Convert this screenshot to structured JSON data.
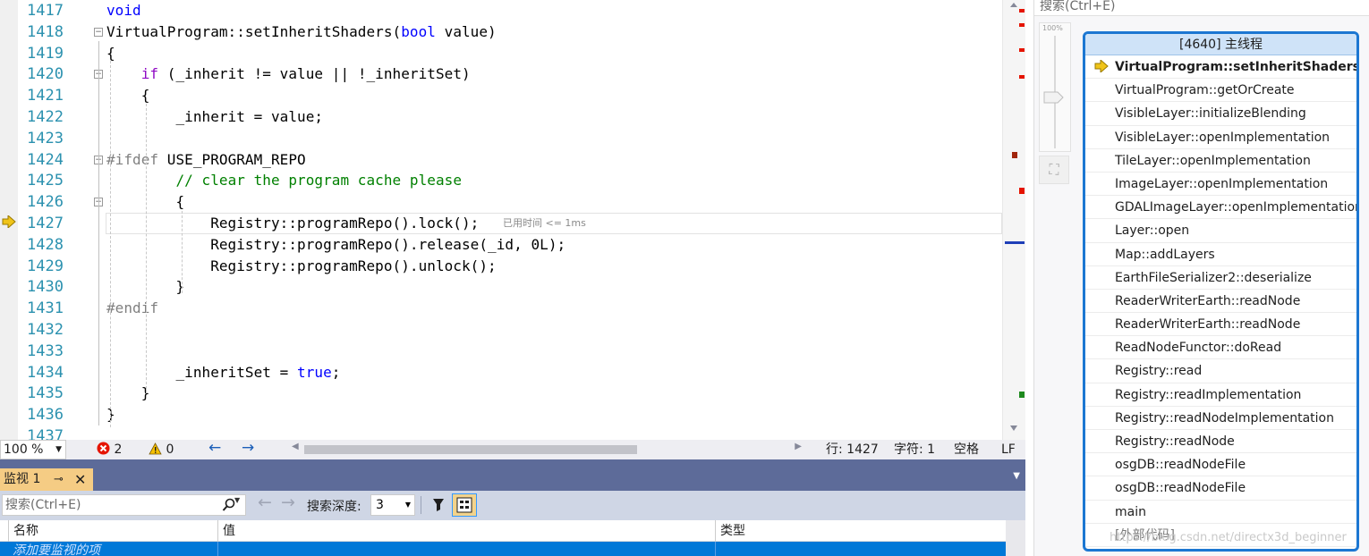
{
  "editor": {
    "lines": [
      {
        "num": "1417",
        "segments": [
          {
            "t": "void",
            "c": "kw"
          }
        ]
      },
      {
        "num": "1418",
        "segments": [
          {
            "t": "VirtualProgram::setInheritShaders(",
            "c": ""
          },
          {
            "t": "bool",
            "c": "kw"
          },
          {
            "t": " value)",
            "c": ""
          }
        ]
      },
      {
        "num": "1419",
        "segments": [
          {
            "t": "{",
            "c": ""
          }
        ]
      },
      {
        "num": "1420",
        "segments": [
          {
            "t": "    ",
            "c": ""
          },
          {
            "t": "if",
            "c": "kw2"
          },
          {
            "t": " (_inherit != value || !_inheritSet)",
            "c": ""
          }
        ]
      },
      {
        "num": "1421",
        "segments": [
          {
            "t": "    {",
            "c": ""
          }
        ]
      },
      {
        "num": "1422",
        "segments": [
          {
            "t": "        _inherit = value;",
            "c": ""
          }
        ]
      },
      {
        "num": "1423",
        "segments": []
      },
      {
        "num": "1424",
        "segments": [
          {
            "t": "#ifdef",
            "c": "pp"
          },
          {
            "t": " USE_PROGRAM_REPO",
            "c": ""
          }
        ]
      },
      {
        "num": "1425",
        "segments": [
          {
            "t": "        ",
            "c": ""
          },
          {
            "t": "// clear the program cache please",
            "c": "cm"
          }
        ]
      },
      {
        "num": "1426",
        "segments": [
          {
            "t": "        {",
            "c": ""
          }
        ]
      },
      {
        "num": "1427",
        "segments": [
          {
            "t": "            Registry::programRepo().lock();",
            "c": ""
          }
        ]
      },
      {
        "num": "1428",
        "segments": [
          {
            "t": "            Registry::programRepo().release(_id, 0L);",
            "c": ""
          }
        ]
      },
      {
        "num": "1429",
        "segments": [
          {
            "t": "            Registry::programRepo().unlock();",
            "c": ""
          }
        ]
      },
      {
        "num": "1430",
        "segments": [
          {
            "t": "        }",
            "c": ""
          }
        ]
      },
      {
        "num": "1431",
        "segments": [
          {
            "t": "#endif",
            "c": "pp"
          }
        ]
      },
      {
        "num": "1432",
        "segments": []
      },
      {
        "num": "1433",
        "segments": []
      },
      {
        "num": "1434",
        "segments": [
          {
            "t": "        _inheritSet = ",
            "c": ""
          },
          {
            "t": "true",
            "c": "kw"
          },
          {
            "t": ";",
            "c": ""
          }
        ]
      },
      {
        "num": "1435",
        "segments": [
          {
            "t": "    }",
            "c": ""
          }
        ]
      },
      {
        "num": "1436",
        "segments": [
          {
            "t": "}",
            "c": ""
          }
        ]
      },
      {
        "num": "1437",
        "segments": []
      }
    ],
    "elapsed_hint": "已用时间 <= 1ms"
  },
  "status_bar": {
    "zoom": "100 %",
    "errors": "2",
    "warnings": "0",
    "line": "行: 1427",
    "char": "字符: 1",
    "whitespace": "空格",
    "eol": "LF"
  },
  "watch": {
    "tab_label": "监视 1",
    "search_placeholder": "搜索(Ctrl+E)",
    "depth_label": "搜索深度:",
    "depth_value": "3",
    "columns": [
      "名称",
      "值",
      "类型"
    ],
    "add_item": "添加要监视的项"
  },
  "parallel_stacks": {
    "search_placeholder": "搜索(Ctrl+E)",
    "zoom_label": "100%",
    "thread_title": "[4640] 主线程",
    "frames": [
      "VirtualProgram::setInheritShaders",
      "VirtualProgram::getOrCreate",
      "VisibleLayer::initializeBlending",
      "VisibleLayer::openImplementation",
      "TileLayer::openImplementation",
      "ImageLayer::openImplementation",
      "GDALImageLayer::openImplementation",
      "Layer::open",
      "Map::addLayers",
      "EarthFileSerializer2::deserialize",
      "ReaderWriterEarth::readNode",
      "ReaderWriterEarth::readNode",
      "ReadNodeFunctor::doRead",
      "Registry::read",
      "Registry::readImplementation",
      "Registry::readNodeImplementation",
      "Registry::readNode",
      "osgDB::readNodeFile",
      "osgDB::readNodeFile",
      "main",
      "[外部代码]"
    ]
  },
  "watermark": "https://blog.csdn.net/directx3d_beginner",
  "colors": {
    "accent": "#1c77d2",
    "watch_title_bg": "#5d6b99",
    "watch_tab_bg": "#f5cc84",
    "selection": "#0078d7",
    "exec_arrow": "#f0c419"
  }
}
